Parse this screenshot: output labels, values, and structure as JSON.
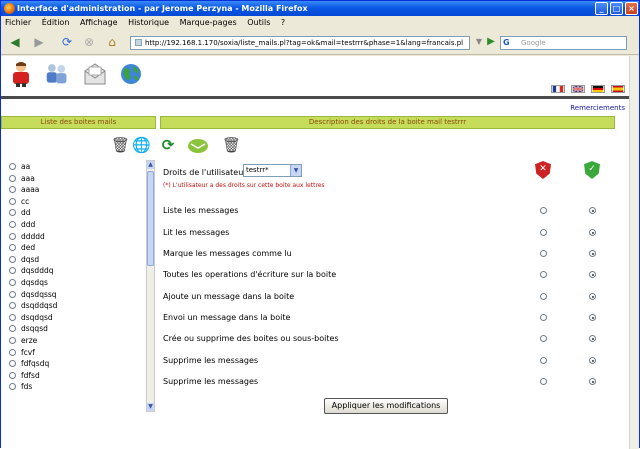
{
  "window": {
    "title": "Interface d'administration - par Jerome Perzyna - Mozilla Firefox",
    "controls": [
      "_",
      "□",
      "×"
    ]
  },
  "menu": [
    "Fichier",
    "Édition",
    "Affichage",
    "Historique",
    "Marque-pages",
    "Outils",
    "?"
  ],
  "nav": {
    "url": "http://192.168.1.170/soxia/liste_mails.pl?tag=ok&mail=testrrr&phase=1&lang=francais.pl",
    "search_placeholder": "Google"
  },
  "header": {
    "thanks_link": "Remerciements",
    "flags": [
      {
        "name": "flag-fr-icon",
        "colors": [
          "#1f3c9a",
          "#ffffff",
          "#d52b1e"
        ],
        "dir": "v"
      },
      {
        "name": "flag-uk-icon",
        "colors": [
          "#1f3c9a",
          "#ffffff",
          "#d52b1e"
        ],
        "dir": "uk"
      },
      {
        "name": "flag-de-icon",
        "colors": [
          "#111111",
          "#dd0000",
          "#ffcc00"
        ],
        "dir": "h"
      },
      {
        "name": "flag-es-icon",
        "colors": [
          "#c60b1e",
          "#ffc400",
          "#c60b1e"
        ],
        "dir": "h"
      }
    ]
  },
  "left_panel": {
    "title": "Liste des boites mails",
    "mailboxes": [
      "aa",
      "aaa",
      "aaaa",
      "cc",
      "dd",
      "ddd",
      "ddddd",
      "ded",
      "dqsd",
      "dqsdddq",
      "dqsdqs",
      "dqsdqssq",
      "dsqddqsd",
      "dsqdqsd",
      "dsqqsd",
      "erze",
      "fcvf",
      "fdfqsdq",
      "fdfsd",
      "fds"
    ]
  },
  "right_panel": {
    "title": "Description des droits de la boite mail testrrr",
    "user_rights_label": "Droits de l'utilisateur",
    "user_select_value": "testrr*",
    "note": "(*) L'utilisateur a des droits sur cette boite aux lettres",
    "permissions": [
      {
        "label": "Liste les messages",
        "selected": "allow"
      },
      {
        "label": "Lit les messages",
        "selected": "allow"
      },
      {
        "label": "Marque les messages comme lu",
        "selected": "allow"
      },
      {
        "label": "Toutes les operations d'écriture sur la boite",
        "selected": "allow"
      },
      {
        "label": "Ajoute un message dans la boite",
        "selected": "allow"
      },
      {
        "label": "Envoi un message dans la boite",
        "selected": "allow"
      },
      {
        "label": "Crée ou supprime des boites ou sous-boites",
        "selected": "allow"
      },
      {
        "label": "Supprime les messages",
        "selected": "allow"
      },
      {
        "label": "Supprime les messages",
        "selected": "allow"
      }
    ],
    "apply_label": "Appliquer les modifications"
  },
  "colors": {
    "accent_bar": "#c5dd5a",
    "bar_text": "#8a4b10",
    "deny": "#cc2222",
    "allow": "#3aa83a"
  }
}
